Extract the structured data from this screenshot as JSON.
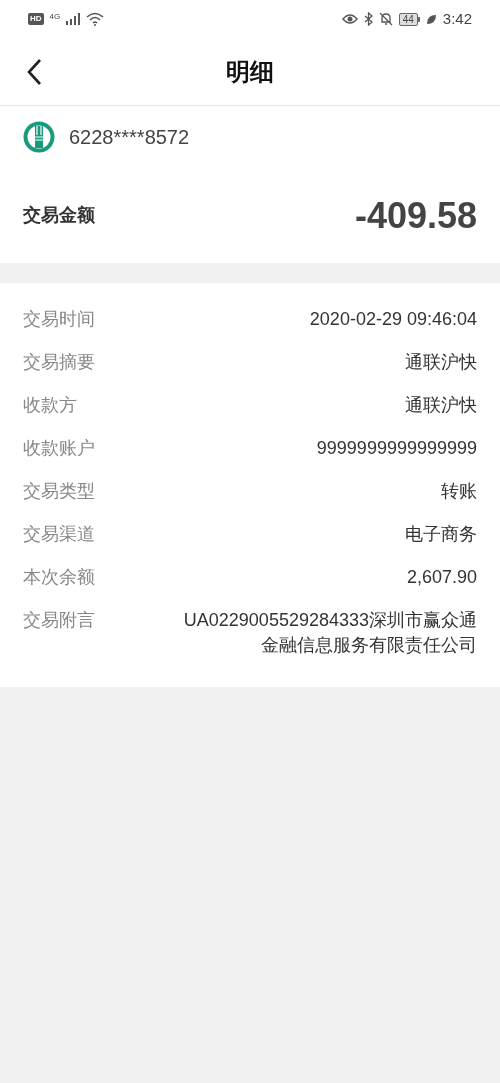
{
  "status_bar": {
    "hd": "HD",
    "network": "4G",
    "battery": "44",
    "time": "3:42"
  },
  "header": {
    "title": "明细"
  },
  "account": {
    "card_number": "6228****8572"
  },
  "amount": {
    "label": "交易金额",
    "value": "-409.58"
  },
  "details": [
    {
      "label": "交易时间",
      "value": "2020-02-29 09:46:04"
    },
    {
      "label": "交易摘要",
      "value": "通联沪快"
    },
    {
      "label": "收款方",
      "value": "通联沪快"
    },
    {
      "label": "收款账户",
      "value": "9999999999999999"
    },
    {
      "label": "交易类型",
      "value": "转账"
    },
    {
      "label": "交易渠道",
      "value": "电子商务"
    },
    {
      "label": "本次余额",
      "value": "2,607.90"
    },
    {
      "label": "交易附言",
      "value": "UA0229005529284333深圳市赢众通金融信息服务有限责任公司"
    }
  ]
}
